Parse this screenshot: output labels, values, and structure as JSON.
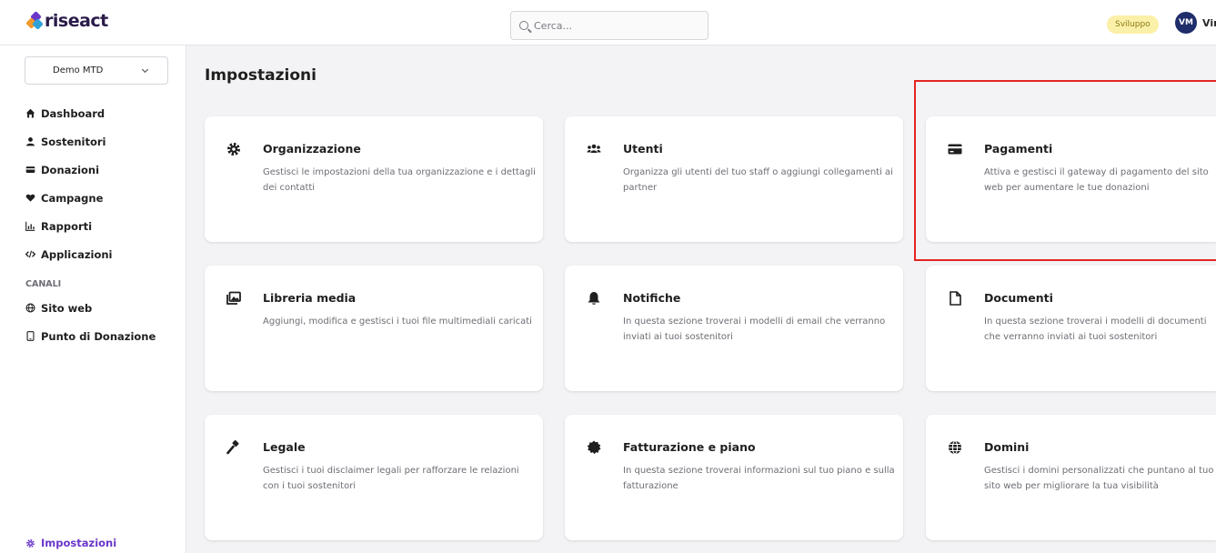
{
  "header": {
    "logo_text": "riseact",
    "search_placeholder": "Cerca...",
    "env_badge": "Sviluppo",
    "avatar_initials": "VM",
    "user_name": "Vir"
  },
  "sidebar": {
    "org_selected": "Demo MTD",
    "nav": [
      {
        "label": "Dashboard",
        "icon": "home-icon"
      },
      {
        "label": "Sostenitori",
        "icon": "user-icon"
      },
      {
        "label": "Donazioni",
        "icon": "credit-card-icon"
      },
      {
        "label": "Campagne",
        "icon": "heart-icon"
      },
      {
        "label": "Rapporti",
        "icon": "chart-icon"
      },
      {
        "label": "Applicazioni",
        "icon": "code-icon"
      }
    ],
    "section_label": "CANALI",
    "channels": [
      {
        "label": "Sito web",
        "icon": "globe-icon"
      },
      {
        "label": "Punto di Donazione",
        "icon": "tablet-icon"
      }
    ],
    "settings_label": "Impostazioni"
  },
  "main": {
    "title": "Impostazioni",
    "cards": [
      {
        "title": "Organizzazione",
        "desc": "Gestisci le impostazioni della tua organizzazione e i dettagli dei contatti",
        "icon": "gear-icon"
      },
      {
        "title": "Utenti",
        "desc": "Organizza gli utenti del tuo staff o aggiungi collegamenti ai partner",
        "icon": "users-icon"
      },
      {
        "title": "Pagamenti",
        "desc": "Attiva e gestisci il gateway di pagamento del sito web per aumentare le tue donazioni",
        "icon": "credit-card-icon"
      },
      {
        "title": "Libreria media",
        "desc": "Aggiungi, modifica e gestisci i tuoi file multimediali caricati",
        "icon": "images-icon"
      },
      {
        "title": "Notifiche",
        "desc": "In questa sezione troverai i modelli di email che verranno inviati ai tuoi sostenitori",
        "icon": "bell-icon"
      },
      {
        "title": "Documenti",
        "desc": "In questa sezione troverai i modelli di documenti che verranno inviati ai tuoi sostenitori",
        "icon": "document-icon"
      },
      {
        "title": "Legale",
        "desc": "Gestisci i tuoi disclaimer legali per rafforzare le relazioni con i tuoi sostenitori",
        "icon": "gavel-icon"
      },
      {
        "title": "Fatturazione e piano",
        "desc": "In questa sezione troverai informazioni sul tuo piano e sulla fatturazione",
        "icon": "badge-icon"
      },
      {
        "title": "Domini",
        "desc": "Gestisci i domini personalizzati che puntano al tuo sito web per migliorare la tua visibilità",
        "icon": "globe-icon"
      }
    ]
  },
  "colors": {
    "accent": "#6a36c9",
    "highlight": "#e52421",
    "badge_bg": "#fbf0a8",
    "avatar_bg": "#1f2d6b"
  }
}
